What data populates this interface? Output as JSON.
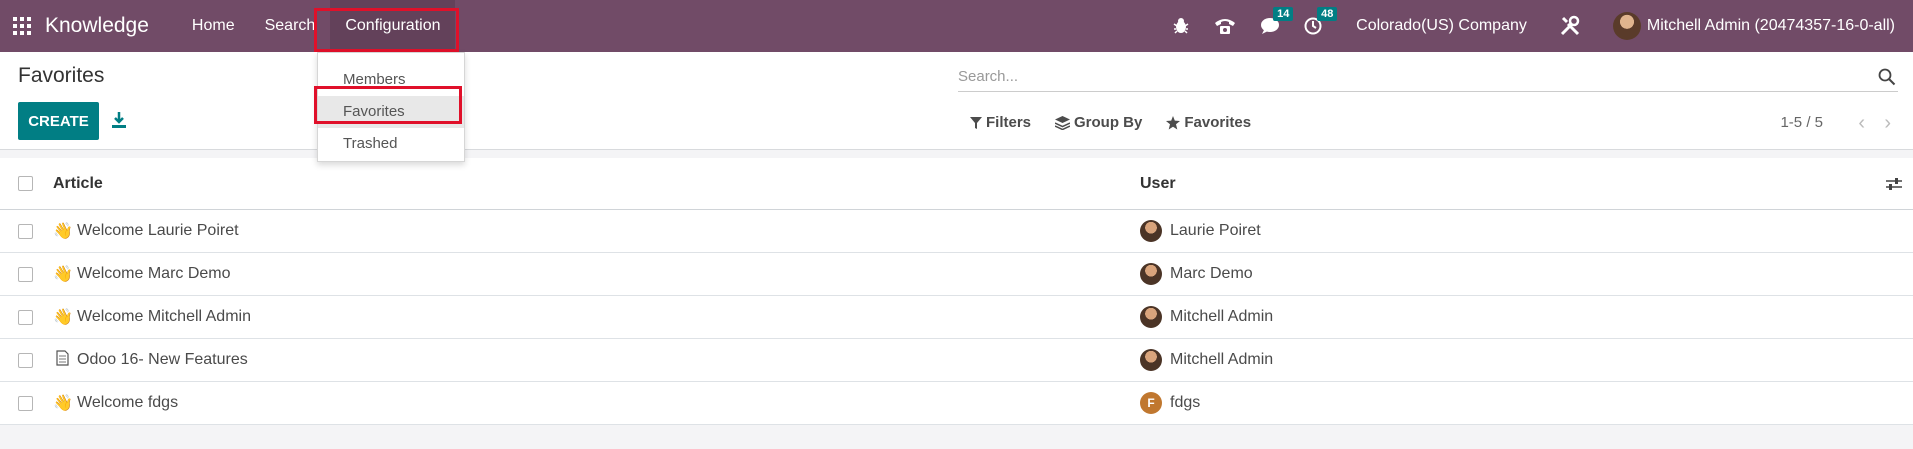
{
  "app": {
    "name": "Knowledge"
  },
  "nav": {
    "items": [
      "Home",
      "Search",
      "Configuration"
    ]
  },
  "systray": {
    "chat_count": "14",
    "activity_count": "48",
    "company": "Colorado(US) Company",
    "user": "Mitchell Admin (20474357-16-0-all)"
  },
  "config_menu": {
    "items": [
      "Members",
      "Favorites",
      "Trashed"
    ]
  },
  "page": {
    "title": "Favorites",
    "create_label": "CREATE"
  },
  "search": {
    "placeholder": "Search..."
  },
  "filters": {
    "filters": "Filters",
    "group_by": "Group By",
    "favorites": "Favorites"
  },
  "pager": {
    "value": "1-5 / 5"
  },
  "table": {
    "columns": {
      "article": "Article",
      "user": "User"
    },
    "rows": [
      {
        "article": "Welcome Laurie Poiret",
        "icon": "waving-hand-icon",
        "user": "Laurie Poiret"
      },
      {
        "article": "Welcome Marc Demo",
        "icon": "waving-hand-icon",
        "user": "Marc Demo"
      },
      {
        "article": "Welcome Mitchell Admin",
        "icon": "waving-hand-icon",
        "user": "Mitchell Admin"
      },
      {
        "article": "Odoo 16- New Features",
        "icon": "page-icon",
        "user": "Mitchell Admin"
      },
      {
        "article": "Welcome fdgs",
        "icon": "waving-hand-icon",
        "user": "fdgs",
        "user_initial": "F"
      }
    ]
  },
  "colors": {
    "navbar": "#714b67",
    "primary": "#017e84",
    "highlight": "#e0102a"
  }
}
